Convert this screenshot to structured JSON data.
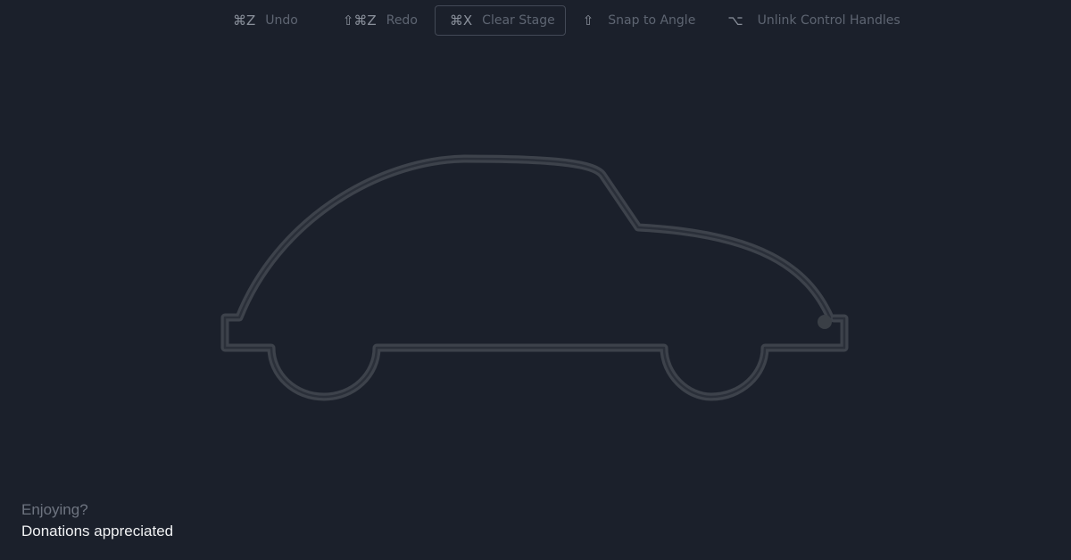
{
  "toolbar": {
    "items": [
      {
        "key": "⌘Z",
        "label": "Undo"
      },
      {
        "key": "⇧⌘Z",
        "label": "Redo"
      },
      {
        "key": "⌘X",
        "label": "Clear Stage"
      },
      {
        "key": "⇧",
        "label": "Snap to Angle"
      },
      {
        "key": "⌥",
        "label": "Unlink Control Handles"
      }
    ],
    "active_item": "Clear Stage"
  },
  "canvas": {
    "shape": "car-outline",
    "stroke_color": "#3d424b",
    "inner_line_color": "#2a2f39",
    "handle_color": "#3a3f46"
  },
  "footer": {
    "question": "Enjoying?",
    "donation_link": "Donations appreciated"
  },
  "colors": {
    "background": "#1b202b",
    "muted_text": "#5e6572",
    "key_text": "#8a909b",
    "link_text": "#f0f1f3"
  }
}
